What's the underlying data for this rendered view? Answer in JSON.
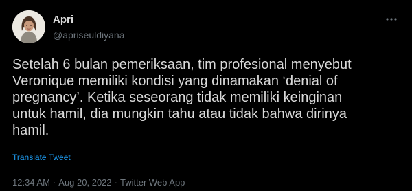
{
  "author": {
    "display_name": "Apri",
    "handle": "@apriseuldiyana",
    "avatar_icon": "person-portrait-icon"
  },
  "more_icon": "more-horizontal-icon",
  "tweet": {
    "text": "Setelah 6 bulan pemeriksaan, tim profesional menyebut\nVeronique memiliki kondisi yang dinamakan ‘denial of\npregnancy’. Ketika seseorang tidak memiliki keinginan\nuntuk hamil, dia mungkin tahu atau tidak bahwa dirinya\nhamil.",
    "translate_label": "Translate Tweet"
  },
  "meta": {
    "time": "12:34 AM",
    "separator": "·",
    "date": "Aug 20, 2022",
    "source": "Twitter Web App"
  },
  "colors": {
    "background": "#000000",
    "text": "#d9d9d9",
    "secondary": "#6e767d",
    "link": "#1d9bf0"
  }
}
